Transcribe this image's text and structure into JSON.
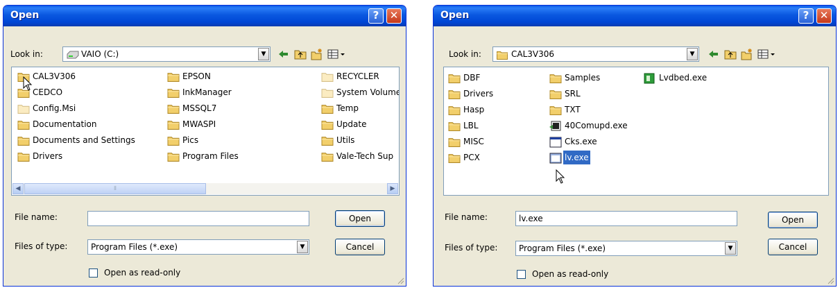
{
  "left_dialog": {
    "title": "Open",
    "help_label": "?",
    "close_label": "✕",
    "look_in_label": "Look in:",
    "look_in_value": "VAIO (C:)",
    "look_in_icon": "drive-icon",
    "files": [
      {
        "name": "CAL3V306",
        "icon": "folder-icon"
      },
      {
        "name": "CEDCO",
        "icon": "folder-icon"
      },
      {
        "name": "Config.Msi",
        "icon": "folder-hidden-icon"
      },
      {
        "name": "Documentation",
        "icon": "folder-icon"
      },
      {
        "name": "Documents and Settings",
        "icon": "folder-icon"
      },
      {
        "name": "Drivers",
        "icon": "folder-icon"
      },
      {
        "name": "EPSON",
        "icon": "folder-icon"
      },
      {
        "name": "InkManager",
        "icon": "folder-icon"
      },
      {
        "name": "MSSQL7",
        "icon": "folder-icon"
      },
      {
        "name": "MWASPI",
        "icon": "folder-icon"
      },
      {
        "name": "Pics",
        "icon": "folder-icon"
      },
      {
        "name": "Program Files",
        "icon": "folder-icon"
      },
      {
        "name": "RECYCLER",
        "icon": "folder-hidden-icon"
      },
      {
        "name": "System Volume",
        "icon": "folder-hidden-icon"
      },
      {
        "name": "Temp",
        "icon": "folder-icon"
      },
      {
        "name": "Update",
        "icon": "folder-icon"
      },
      {
        "name": "Utils",
        "icon": "folder-icon"
      },
      {
        "name": "Vale-Tech Sup",
        "icon": "folder-icon"
      }
    ],
    "scroll_left": "◀",
    "scroll_right": "▶",
    "scroll_grip": "⦀",
    "file_name_label": "File name:",
    "file_name_value": "",
    "files_of_type_label": "Files of type:",
    "files_of_type_value": "Program Files (*.exe)",
    "open_button": "Open",
    "cancel_button": "Cancel",
    "read_only_label": "Open as read-only",
    "read_only_checked": false
  },
  "right_dialog": {
    "title": "Open",
    "help_label": "?",
    "close_label": "✕",
    "look_in_label": "Look in:",
    "look_in_value": "CAL3V306",
    "look_in_icon": "folder-icon",
    "files": [
      {
        "name": "DBF",
        "icon": "folder-icon"
      },
      {
        "name": "Drivers",
        "icon": "folder-icon"
      },
      {
        "name": "Hasp",
        "icon": "folder-icon"
      },
      {
        "name": "LBL",
        "icon": "folder-icon"
      },
      {
        "name": "MISC",
        "icon": "folder-icon"
      },
      {
        "name": "PCX",
        "icon": "folder-icon"
      },
      {
        "name": "Samples",
        "icon": "folder-icon"
      },
      {
        "name": "SRL",
        "icon": "folder-icon"
      },
      {
        "name": "TXT",
        "icon": "folder-icon"
      },
      {
        "name": "40Comupd.exe",
        "icon": "installer-icon"
      },
      {
        "name": "Cks.exe",
        "icon": "window-app-icon"
      },
      {
        "name": "lv.exe",
        "icon": "exe-app-icon",
        "selected": true
      },
      {
        "name": "Lvdbed.exe",
        "icon": "green-app-icon"
      }
    ],
    "file_name_label": "File name:",
    "file_name_value": "lv.exe",
    "files_of_type_label": "Files of type:",
    "files_of_type_value": "Program Files (*.exe)",
    "open_button": "Open",
    "cancel_button": "Cancel",
    "read_only_label": "Open as read-only",
    "read_only_checked": false
  },
  "colors": {
    "title_bar": "#0a58e0",
    "dialog_bg": "#ece9d8",
    "selection": "#316ac5",
    "folder": "#f2cf6b"
  },
  "dropdown_arrow": "▼"
}
